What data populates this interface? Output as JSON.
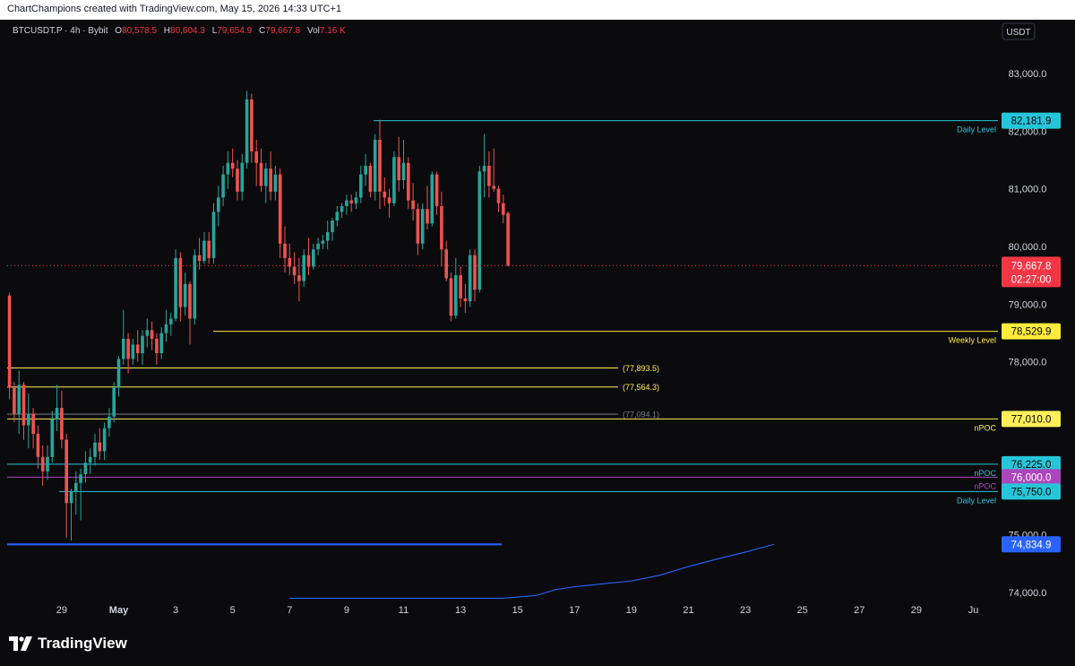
{
  "header": {
    "attribution": "ChartChampions created with TradingView.com, May 15, 2026 14:33 UTC+1"
  },
  "legend": {
    "symbol": "BTCUSDT.P · 4h · Bybit",
    "o_label": "O",
    "o_value": "80,578.5",
    "h_label": "H",
    "h_value": "80,604.3",
    "l_label": "L",
    "l_value": "79,654.9",
    "c_label": "C",
    "c_value": "79,667.8",
    "vol_label": "Vol",
    "vol_value": "7.16 K"
  },
  "currency_badge": "USDT",
  "branding": "TradingView",
  "colors": {
    "up": "#26a69a",
    "down": "#ef5350",
    "daily_level": "#26c6da",
    "weekly_level": "#ffeb3b",
    "npoc_yellow": "#ffee58",
    "npoc_purple": "#ab47bc",
    "blue_line": "#2962ff",
    "current_price": "#f23645"
  },
  "chart_data": {
    "type": "candlestick",
    "timeframe": "4h",
    "symbol": "BTCUSDT.P",
    "exchange": "Bybit",
    "ylim": [
      73900,
      83700
    ],
    "y_ticks": [
      {
        "value": 74000,
        "label": "74,000.0"
      },
      {
        "value": 75000,
        "label": "75,000.0"
      },
      {
        "value": 78000,
        "label": "78,000.0"
      },
      {
        "value": 79000,
        "label": "79,000.0"
      },
      {
        "value": 80000,
        "label": "80,000.0"
      },
      {
        "value": 81000,
        "label": "81,000.0"
      },
      {
        "value": 82000,
        "label": "82,000.0"
      },
      {
        "value": 83000,
        "label": "83,000.0"
      }
    ],
    "x_ticks": [
      {
        "pos": 6,
        "label": "29"
      },
      {
        "pos": 18,
        "label": "May"
      },
      {
        "pos": 30,
        "label": "3"
      },
      {
        "pos": 42,
        "label": "5"
      },
      {
        "pos": 54,
        "label": "7"
      },
      {
        "pos": 66,
        "label": "9"
      },
      {
        "pos": 78,
        "label": "11"
      },
      {
        "pos": 90,
        "label": "13"
      },
      {
        "pos": 102,
        "label": "15"
      },
      {
        "pos": 114,
        "label": "17"
      },
      {
        "pos": 126,
        "label": "19"
      },
      {
        "pos": 138,
        "label": "21"
      },
      {
        "pos": 150,
        "label": "23"
      },
      {
        "pos": 162,
        "label": "25"
      },
      {
        "pos": 174,
        "label": "27"
      },
      {
        "pos": 186,
        "label": "29"
      },
      {
        "pos": 198,
        "label": "Ju"
      }
    ],
    "candles": [
      [
        79150,
        79200,
        77350,
        77550
      ],
      [
        77550,
        77650,
        76950,
        77100
      ],
      [
        77100,
        77850,
        76750,
        77600
      ],
      [
        77600,
        77650,
        76650,
        76900
      ],
      [
        76900,
        77450,
        76500,
        77100
      ],
      [
        77100,
        77200,
        76500,
        76750
      ],
      [
        76750,
        76900,
        76150,
        76350
      ],
      [
        76350,
        76550,
        75850,
        76100
      ],
      [
        76100,
        76550,
        75950,
        76350
      ],
      [
        76350,
        77150,
        76250,
        77000
      ],
      [
        77000,
        77600,
        76800,
        77200
      ],
      [
        77200,
        77500,
        76500,
        76650
      ],
      [
        76650,
        76750,
        74950,
        75550
      ],
      [
        75550,
        75800,
        74900,
        75750
      ],
      [
        75750,
        76100,
        75350,
        75900
      ],
      [
        75900,
        76150,
        75250,
        76050
      ],
      [
        76050,
        76450,
        75900,
        76250
      ],
      [
        76250,
        76500,
        76050,
        76350
      ],
      [
        76350,
        76750,
        76200,
        76600
      ],
      [
        76600,
        76850,
        76300,
        76450
      ],
      [
        76450,
        76950,
        76300,
        76850
      ],
      [
        76850,
        77200,
        76700,
        77050
      ],
      [
        77050,
        77650,
        76950,
        77550
      ],
      [
        77550,
        78100,
        77400,
        78050
      ],
      [
        78050,
        78900,
        77950,
        78400
      ],
      [
        78400,
        78500,
        77800,
        78050
      ],
      [
        78050,
        78400,
        77950,
        78300
      ],
      [
        78300,
        78550,
        78000,
        78150
      ],
      [
        78150,
        78550,
        77950,
        78450
      ],
      [
        78450,
        78750,
        78250,
        78550
      ],
      [
        78550,
        78700,
        78200,
        78400
      ],
      [
        78400,
        78500,
        77950,
        78150
      ],
      [
        78150,
        78600,
        78050,
        78500
      ],
      [
        78500,
        78900,
        78350,
        78650
      ],
      [
        78650,
        78850,
        78450,
        78750
      ],
      [
        78750,
        79950,
        78700,
        79800
      ],
      [
        79800,
        79900,
        78700,
        78950
      ],
      [
        78950,
        79550,
        78800,
        79350
      ],
      [
        79350,
        79400,
        78300,
        78750
      ],
      [
        78750,
        79950,
        78650,
        79850
      ],
      [
        79850,
        80150,
        79600,
        79750
      ],
      [
        79750,
        80250,
        79700,
        80100
      ],
      [
        80100,
        80250,
        79700,
        79800
      ],
      [
        79800,
        80750,
        79700,
        80600
      ],
      [
        80600,
        81050,
        80350,
        80850
      ],
      [
        80850,
        81400,
        80700,
        81250
      ],
      [
        81250,
        81650,
        81000,
        81450
      ],
      [
        81450,
        81700,
        81200,
        81350
      ],
      [
        81350,
        81500,
        80800,
        80950
      ],
      [
        80950,
        81600,
        80800,
        81450
      ],
      [
        81450,
        82700,
        81350,
        82550
      ],
      [
        82550,
        82650,
        81450,
        81650
      ],
      [
        81650,
        81850,
        81050,
        81450
      ],
      [
        81450,
        81700,
        80950,
        81050
      ],
      [
        81050,
        81450,
        80750,
        81350
      ],
      [
        81350,
        81650,
        80800,
        80950
      ],
      [
        80950,
        81400,
        80800,
        81250
      ],
      [
        81250,
        81350,
        79800,
        80050
      ],
      [
        80050,
        80350,
        79550,
        79800
      ],
      [
        79800,
        80050,
        79500,
        79650
      ],
      [
        79650,
        79900,
        79350,
        79500
      ],
      [
        79500,
        79800,
        79050,
        79400
      ],
      [
        79400,
        79950,
        79300,
        79850
      ],
      [
        79850,
        80150,
        79500,
        79650
      ],
      [
        79650,
        80050,
        79600,
        79950
      ],
      [
        79950,
        80150,
        79850,
        80050
      ],
      [
        80050,
        80200,
        79950,
        80100
      ],
      [
        80100,
        80450,
        79950,
        80250
      ],
      [
        80250,
        80500,
        80100,
        80450
      ],
      [
        80450,
        80700,
        80350,
        80600
      ],
      [
        80600,
        80750,
        80500,
        80700
      ],
      [
        80700,
        80900,
        80550,
        80800
      ],
      [
        80800,
        80900,
        80600,
        80750
      ],
      [
        80750,
        80950,
        80650,
        80850
      ],
      [
        80850,
        81400,
        80750,
        81250
      ],
      [
        81250,
        81600,
        81050,
        81400
      ],
      [
        81400,
        81450,
        80850,
        80950
      ],
      [
        80950,
        81950,
        80800,
        81850
      ],
      [
        81850,
        82200,
        80650,
        80950
      ],
      [
        80950,
        81200,
        80700,
        80850
      ],
      [
        80850,
        81000,
        80500,
        80750
      ],
      [
        80750,
        81650,
        80700,
        81550
      ],
      [
        81550,
        81900,
        80950,
        81150
      ],
      [
        81150,
        81850,
        81000,
        81450
      ],
      [
        81450,
        81550,
        80650,
        80800
      ],
      [
        80800,
        81100,
        80450,
        80650
      ],
      [
        80650,
        80750,
        79850,
        80050
      ],
      [
        80050,
        80750,
        79950,
        80650
      ],
      [
        80650,
        81050,
        80300,
        80400
      ],
      [
        80400,
        81300,
        80350,
        81250
      ],
      [
        81250,
        81300,
        80550,
        80700
      ],
      [
        80700,
        80950,
        79650,
        79950
      ],
      [
        79950,
        80100,
        79400,
        79450
      ],
      [
        79450,
        79550,
        78700,
        78800
      ],
      [
        78800,
        79800,
        78750,
        79500
      ],
      [
        79500,
        79650,
        78950,
        79100
      ],
      [
        79100,
        79350,
        78850,
        79050
      ],
      [
        79050,
        79950,
        78950,
        79850
      ],
      [
        79850,
        79950,
        79050,
        79250
      ],
      [
        79250,
        81400,
        79200,
        81300
      ],
      [
        81300,
        81950,
        80850,
        81400
      ],
      [
        81400,
        81650,
        80850,
        81050
      ],
      [
        81050,
        81700,
        80950,
        81000
      ],
      [
        81000,
        81050,
        80600,
        80750
      ],
      [
        80750,
        80900,
        80400,
        80550
      ],
      [
        80578.5,
        80604.3,
        79654.9,
        79667.8
      ]
    ],
    "levels": [
      {
        "value": 82181.9,
        "label": "82,181.9",
        "name": "Daily Level",
        "color": "#26c6da"
      },
      {
        "value": 78529.9,
        "label": "78,529.9",
        "name": "Weekly Level",
        "color": "#ffeb3b"
      },
      {
        "value": 77893.5,
        "label": "(77,893.5)",
        "color": "#ffee58"
      },
      {
        "value": 77564.3,
        "label": "(77,564.3)",
        "color": "#ffee58"
      },
      {
        "value": 77094.1,
        "label": "(77,094.1)",
        "color": "#787b86"
      },
      {
        "value": 77010.0,
        "label": "77,010.0",
        "name": "nPOC",
        "color": "#ffee58"
      },
      {
        "value": 76225.0,
        "label": "76,225.0",
        "name": "nPOC",
        "color": "#26c6da"
      },
      {
        "value": 76000.0,
        "label": "76,000.0",
        "name": "nPOC",
        "color": "#ab47bc"
      },
      {
        "value": 75750.0,
        "label": "75,750.0",
        "name": "Daily Level",
        "color": "#26c6da"
      },
      {
        "value": 74834.9,
        "label": "74,834.9",
        "color": "#2962ff"
      }
    ],
    "current_price": {
      "value": 79667.8,
      "label": "79,667.8",
      "countdown": "02:27:00"
    },
    "blue_curve": [
      [
        0,
        73900
      ],
      [
        45,
        73900
      ],
      [
        52,
        73950
      ],
      [
        56,
        74050
      ],
      [
        60,
        74100
      ],
      [
        66,
        74150
      ],
      [
        72,
        74200
      ],
      [
        78,
        74300
      ],
      [
        84,
        74450
      ],
      [
        90,
        74580
      ],
      [
        96,
        74700
      ],
      [
        102,
        74835
      ]
    ]
  }
}
